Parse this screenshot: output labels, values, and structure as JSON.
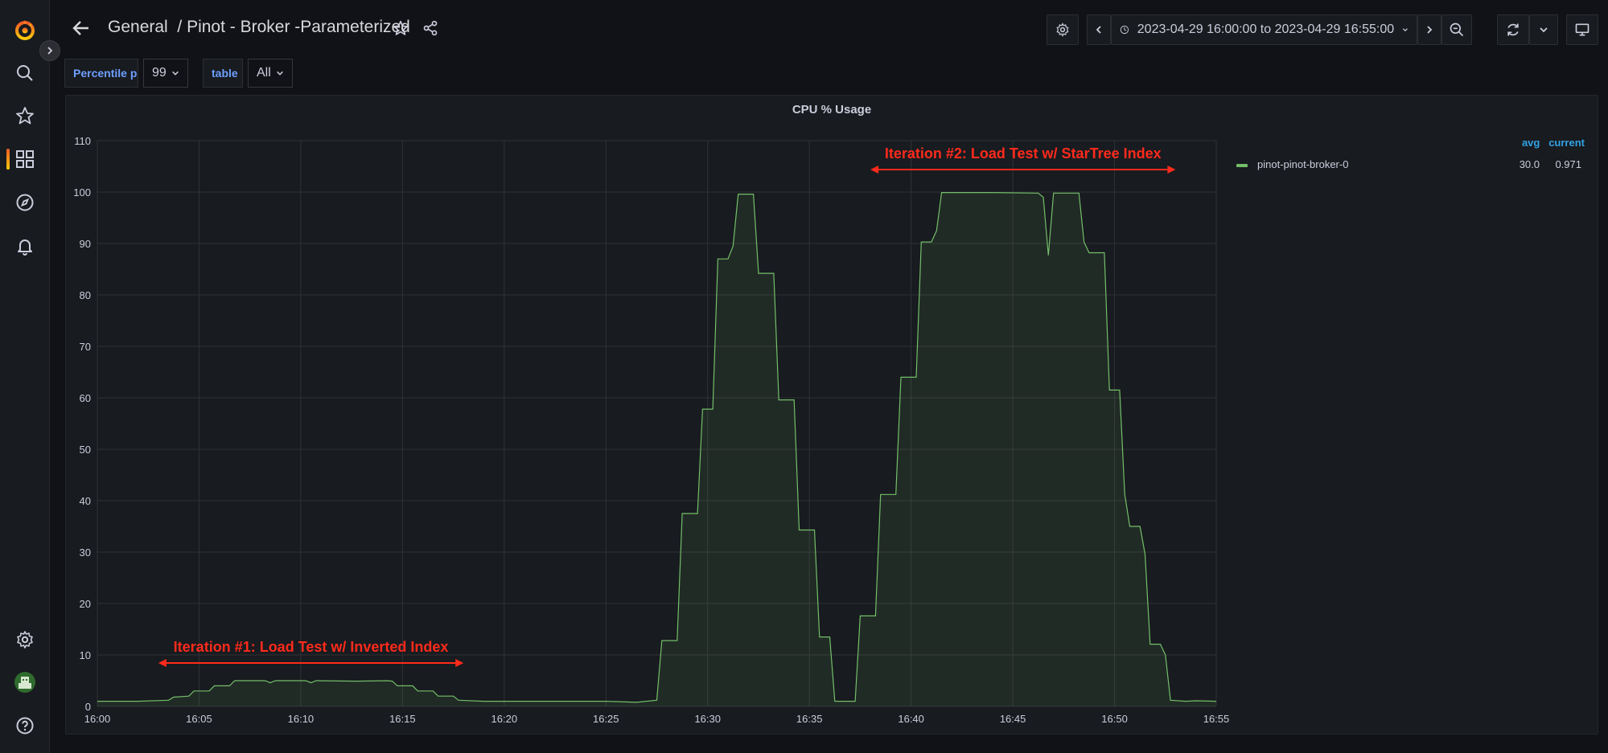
{
  "sidebar": {
    "items": [
      {
        "name": "grafana-logo-icon"
      },
      {
        "name": "search-icon"
      },
      {
        "name": "star-icon"
      },
      {
        "name": "dashboards-icon"
      },
      {
        "name": "explore-compass-icon"
      },
      {
        "name": "alerting-bell-icon"
      },
      {
        "name": "settings-gear-icon"
      },
      {
        "name": "user-avatar-icon"
      },
      {
        "name": "help-icon"
      }
    ]
  },
  "header": {
    "folder": "General",
    "separator": "/",
    "dashboard": "Pinot - Broker -Parameterized",
    "time_range": "2023-04-29 16:00:00 to 2023-04-29 16:55:00"
  },
  "variables": [
    {
      "label": "Percentile p",
      "value": "99"
    },
    {
      "label": "table",
      "value": "All"
    }
  ],
  "colors": {
    "series": "#73bf69",
    "annotation": "#ff2a1c",
    "legend_header": "#33a2e5",
    "var_label": "#6e9fff"
  },
  "panel": {
    "title": "CPU % Usage",
    "legend": {
      "headers": [
        "avg",
        "current"
      ],
      "rows": [
        {
          "name": "pinot-pinot-broker-0",
          "avg": "30.0",
          "current": "0.971"
        }
      ]
    },
    "annotations": [
      {
        "text": "Iteration #1: Load Test w/ Inverted Index",
        "from": "16:03",
        "to": "16:18"
      },
      {
        "text": "Iteration #2: Load Test w/ StarTree Index",
        "from": "16:38",
        "to": "16:53"
      }
    ]
  },
  "chart_data": {
    "type": "area",
    "title": "CPU % Usage",
    "xlabel": "",
    "ylabel": "",
    "ylim": [
      0,
      110
    ],
    "yticks": [
      0,
      10,
      20,
      30,
      40,
      50,
      60,
      70,
      80,
      90,
      100,
      110
    ],
    "xticks": [
      "16:00",
      "16:05",
      "16:10",
      "16:15",
      "16:20",
      "16:25",
      "16:30",
      "16:35",
      "16:40",
      "16:45",
      "16:50",
      "16:55"
    ],
    "xrange": [
      "16:00",
      "16:55"
    ],
    "grid": true,
    "legend": "right",
    "series": [
      {
        "name": "pinot-pinot-broker-0",
        "color": "#73bf69",
        "points": [
          [
            "16:00:00",
            1
          ],
          [
            "16:02:00",
            1
          ],
          [
            "16:03:30",
            1.2
          ],
          [
            "16:03:45",
            1.8
          ],
          [
            "16:04:30",
            2
          ],
          [
            "16:04:45",
            3
          ],
          [
            "16:05:30",
            3
          ],
          [
            "16:05:45",
            4
          ],
          [
            "16:06:30",
            4
          ],
          [
            "16:06:45",
            5
          ],
          [
            "16:08:15",
            5
          ],
          [
            "16:08:30",
            4.6
          ],
          [
            "16:08:45",
            5
          ],
          [
            "16:10:15",
            5
          ],
          [
            "16:10:30",
            4.6
          ],
          [
            "16:10:45",
            5
          ],
          [
            "16:12:45",
            4.9
          ],
          [
            "16:14:15",
            5
          ],
          [
            "16:14:30",
            4.9
          ],
          [
            "16:14:45",
            4
          ],
          [
            "16:15:30",
            4
          ],
          [
            "16:15:45",
            3
          ],
          [
            "16:16:30",
            3
          ],
          [
            "16:16:45",
            2
          ],
          [
            "16:17:30",
            2
          ],
          [
            "16:17:45",
            1.2
          ],
          [
            "16:19:00",
            1
          ],
          [
            "16:22:00",
            1
          ],
          [
            "16:25:00",
            1
          ],
          [
            "16:26:30",
            0.8
          ],
          [
            "16:27:30",
            1.2
          ],
          [
            "16:27:45",
            12.8
          ],
          [
            "16:28:30",
            12.8
          ],
          [
            "16:28:45",
            37.5
          ],
          [
            "16:29:30",
            37.5
          ],
          [
            "16:29:45",
            57.8
          ],
          [
            "16:30:15",
            57.8
          ],
          [
            "16:30:30",
            87
          ],
          [
            "16:31:00",
            87
          ],
          [
            "16:31:15",
            89.5
          ],
          [
            "16:31:30",
            99.6
          ],
          [
            "16:32:15",
            99.6
          ],
          [
            "16:32:30",
            84.2
          ],
          [
            "16:33:15",
            84.2
          ],
          [
            "16:33:30",
            59.6
          ],
          [
            "16:34:15",
            59.6
          ],
          [
            "16:34:30",
            34.3
          ],
          [
            "16:35:15",
            34.3
          ],
          [
            "16:35:30",
            13.5
          ],
          [
            "16:36:00",
            13.5
          ],
          [
            "16:36:15",
            1
          ],
          [
            "16:37:15",
            1
          ],
          [
            "16:37:30",
            17.6
          ],
          [
            "16:38:15",
            17.6
          ],
          [
            "16:38:30",
            41.2
          ],
          [
            "16:39:15",
            41.2
          ],
          [
            "16:39:30",
            64
          ],
          [
            "16:40:15",
            64
          ],
          [
            "16:40:30",
            90.3
          ],
          [
            "16:41:00",
            90.3
          ],
          [
            "16:41:15",
            92.5
          ],
          [
            "16:41:30",
            99.9
          ],
          [
            "16:44:00",
            99.9
          ],
          [
            "16:46:15",
            99.8
          ],
          [
            "16:46:30",
            99
          ],
          [
            "16:46:45",
            87.7
          ],
          [
            "16:47:00",
            99.8
          ],
          [
            "16:48:15",
            99.8
          ],
          [
            "16:48:30",
            90.3
          ],
          [
            "16:48:45",
            88.2
          ],
          [
            "16:49:30",
            88.2
          ],
          [
            "16:49:45",
            61.5
          ],
          [
            "16:50:15",
            61.5
          ],
          [
            "16:50:30",
            41.3
          ],
          [
            "16:50:45",
            35
          ],
          [
            "16:51:15",
            35
          ],
          [
            "16:51:30",
            29.6
          ],
          [
            "16:51:45",
            12.1
          ],
          [
            "16:52:15",
            12.1
          ],
          [
            "16:52:30",
            10
          ],
          [
            "16:52:45",
            1.2
          ],
          [
            "16:53:30",
            1
          ],
          [
            "16:54:00",
            1.1
          ],
          [
            "16:55:00",
            1
          ]
        ]
      }
    ]
  }
}
